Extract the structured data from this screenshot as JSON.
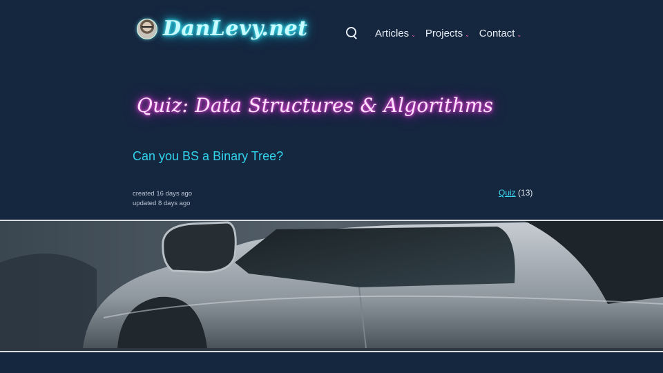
{
  "header": {
    "logo_text": "DanLevy.net",
    "nav": [
      {
        "label": "Articles"
      },
      {
        "label": "Projects"
      },
      {
        "label": "Contact"
      }
    ]
  },
  "article": {
    "title": "Quiz: Data Structures & Algorithms",
    "subtitle": "Can you BS a Binary Tree?",
    "created": "created 16 days ago",
    "updated": "updated 8 days ago",
    "tag": {
      "label": "Quiz",
      "count": "(13)"
    }
  },
  "colors": {
    "background": "#15263f",
    "logo_glow": "#2fd8f0",
    "title_glow": "#e23ad8",
    "link": "#31d3ec",
    "nav_chevron": "#ff5fa8"
  },
  "icons": {
    "search": "search-icon",
    "chevron": "chevron-down-icon"
  }
}
